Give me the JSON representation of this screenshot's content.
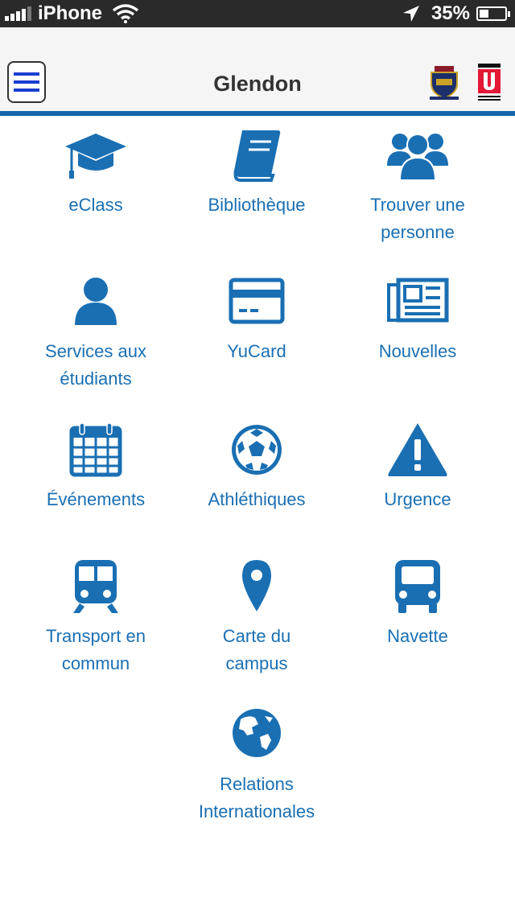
{
  "status_bar": {
    "carrier": "iPhone",
    "battery": "35%",
    "battery_level": 0.35,
    "icons": [
      "signal-icon",
      "wifi-icon",
      "location-icon",
      "battery-icon"
    ]
  },
  "nav": {
    "title": "Glendon",
    "menu_icon": "hamburger-icon",
    "logos": [
      "glendon-logo",
      "york-logo"
    ]
  },
  "colors": {
    "accent": "#1a6fb3",
    "nav_border": "#1566a8",
    "menu_lines": "#1a3fcf"
  },
  "tiles": [
    {
      "label": "eClass",
      "icon": "graduation-cap-icon"
    },
    {
      "label": "Bibliothèque",
      "icon": "book-icon"
    },
    {
      "label": "Trouver une\npersonne",
      "icon": "people-icon"
    },
    {
      "label": "Services aux\nétudiants",
      "icon": "person-icon"
    },
    {
      "label": "YuCard",
      "icon": "card-icon"
    },
    {
      "label": "Nouvelles",
      "icon": "newspaper-icon"
    },
    {
      "label": "Événements",
      "icon": "calendar-icon"
    },
    {
      "label": "Athléthiques",
      "icon": "soccer-ball-icon"
    },
    {
      "label": "Urgence",
      "icon": "warning-icon"
    },
    {
      "label": "Transport en\ncommun",
      "icon": "train-icon"
    },
    {
      "label": "Carte du\ncampus",
      "icon": "map-pin-icon"
    },
    {
      "label": "Navette",
      "icon": "bus-icon"
    },
    {
      "label": "Relations\nInternationales",
      "icon": "globe-icon"
    }
  ]
}
